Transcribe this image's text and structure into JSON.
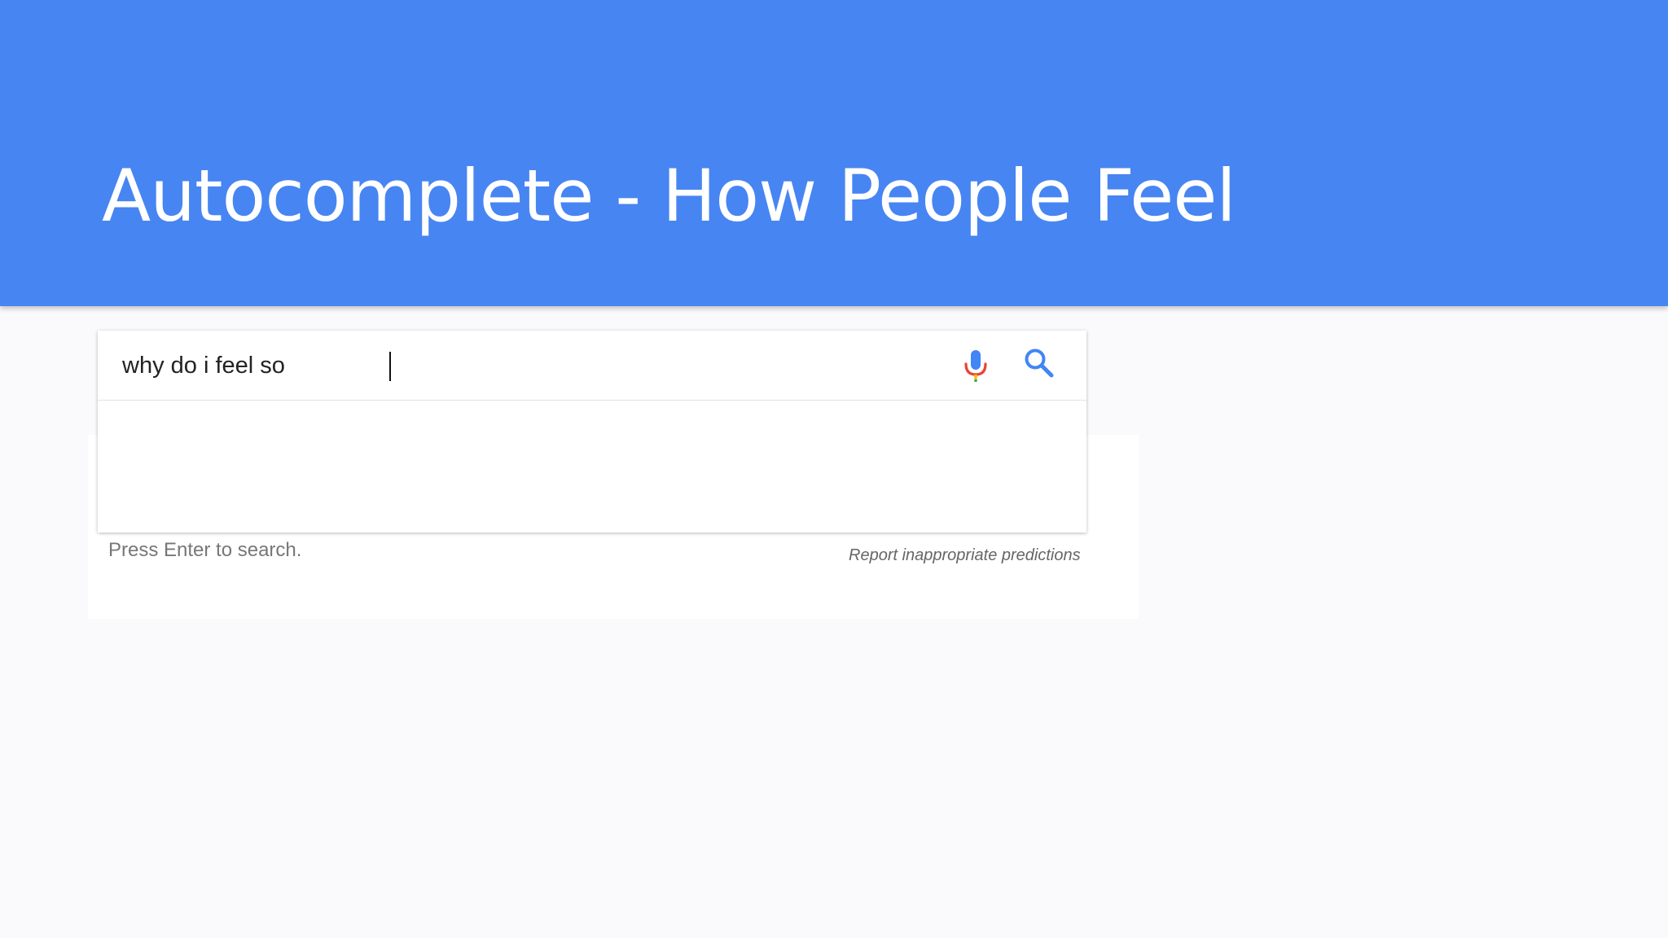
{
  "slide": {
    "title": "Autocomplete - How People Feel"
  },
  "search": {
    "query": "why do i feel so",
    "voice_icon": "microphone-icon",
    "search_icon": "magnifier-icon"
  },
  "hint": {
    "press_enter": "Press Enter to search."
  },
  "footer": {
    "report_link": "Report inappropriate predictions"
  },
  "colors": {
    "header_bg": "#4785f2",
    "page_bg": "#faf9fb",
    "search_icon_blue": "#4285f4",
    "mic_blue": "#4285f4",
    "mic_red": "#ea4335"
  }
}
